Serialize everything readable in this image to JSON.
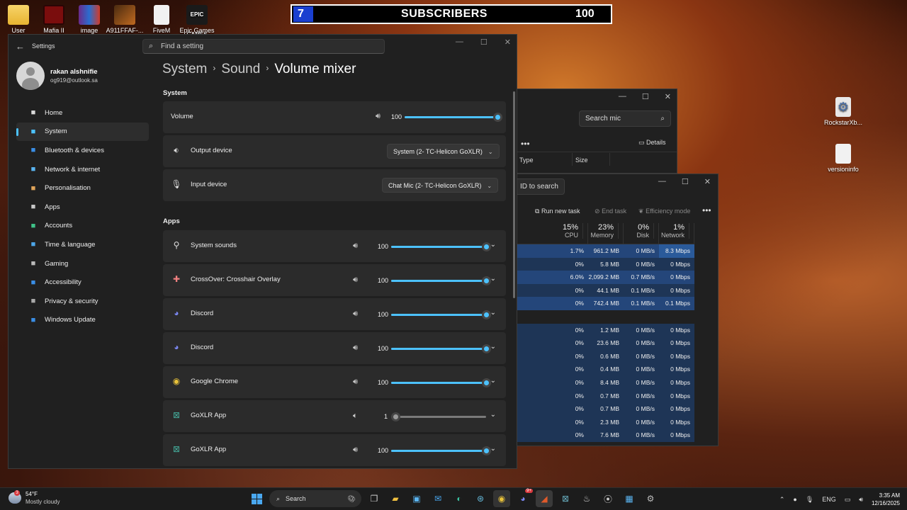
{
  "desktop": {
    "icons": [
      "User",
      "Mafia II",
      "image",
      "A911FFAF-...",
      "FiveM",
      "Epic Games"
    ],
    "right_icons": [
      "RockstarXb...",
      "versioninfo"
    ],
    "epic_logo": "EPIC GAMES"
  },
  "banner": {
    "number": "7",
    "label": "SUBSCRIBERS",
    "count": "100"
  },
  "explorer": {
    "search_placeholder": "Search mic",
    "details": "Details",
    "col_type": "Type",
    "col_size": "Size"
  },
  "task_manager": {
    "search_placeholder": "ID to search",
    "run_new_task": "Run new task",
    "end_task": "End task",
    "efficiency_mode": "Efficiency mode",
    "headers": [
      {
        "pct": "15%",
        "name": "CPU"
      },
      {
        "pct": "23%",
        "name": "Memory"
      },
      {
        "pct": "0%",
        "name": "Disk"
      },
      {
        "pct": "1%",
        "name": "Network"
      }
    ],
    "rows": [
      [
        "1.7%",
        "961.2 MB",
        "0 MB/s",
        "8.3 Mbps"
      ],
      [
        "0%",
        "5.8 MB",
        "0 MB/s",
        "0 Mbps"
      ],
      [
        "6.0%",
        "2,099.2 MB",
        "0.7 MB/s",
        "0 Mbps"
      ],
      [
        "0%",
        "44.1 MB",
        "0.1 MB/s",
        "0 Mbps"
      ],
      [
        "0%",
        "742.4 MB",
        "0.1 MB/s",
        "0.1 Mbps"
      ],
      [
        "",
        "",
        "",
        ""
      ],
      [
        "0%",
        "1.2 MB",
        "0 MB/s",
        "0 Mbps"
      ],
      [
        "0%",
        "23.6 MB",
        "0 MB/s",
        "0 Mbps"
      ],
      [
        "0%",
        "0.6 MB",
        "0 MB/s",
        "0 Mbps"
      ],
      [
        "0%",
        "0.4 MB",
        "0 MB/s",
        "0 Mbps"
      ],
      [
        "0%",
        "8.4 MB",
        "0 MB/s",
        "0 Mbps"
      ],
      [
        "0%",
        "0.7 MB",
        "0 MB/s",
        "0 Mbps"
      ],
      [
        "0%",
        "0.7 MB",
        "0 MB/s",
        "0 Mbps"
      ],
      [
        "0%",
        "2.3 MB",
        "0 MB/s",
        "0 Mbps"
      ],
      [
        "0%",
        "7.6 MB",
        "0 MB/s",
        "0 Mbps"
      ]
    ]
  },
  "settings": {
    "app_title": "Settings",
    "search_placeholder": "Find a setting",
    "user": {
      "name": "rakan alshnifie",
      "email": "og919@outlook.sa"
    },
    "nav": [
      {
        "label": "Home",
        "icon": "home-icon",
        "color": "#d9d9d9"
      },
      {
        "label": "System",
        "icon": "system-icon",
        "color": "#4cc2ff",
        "active": true
      },
      {
        "label": "Bluetooth & devices",
        "icon": "bluetooth-icon",
        "color": "#3a8ee6"
      },
      {
        "label": "Network & internet",
        "icon": "network-icon",
        "color": "#5ab4f0"
      },
      {
        "label": "Personalisation",
        "icon": "brush-icon",
        "color": "#e0a45a"
      },
      {
        "label": "Apps",
        "icon": "apps-icon",
        "color": "#c9c9c9"
      },
      {
        "label": "Accounts",
        "icon": "accounts-icon",
        "color": "#3fc389"
      },
      {
        "label": "Time & language",
        "icon": "globe-icon",
        "color": "#4da6e8"
      },
      {
        "label": "Gaming",
        "icon": "gaming-icon",
        "color": "#bbbbbb"
      },
      {
        "label": "Accessibility",
        "icon": "accessibility-icon",
        "color": "#3a8ee6"
      },
      {
        "label": "Privacy & security",
        "icon": "shield-icon",
        "color": "#aaaaaa"
      },
      {
        "label": "Windows Update",
        "icon": "update-icon",
        "color": "#3a8ee6"
      }
    ],
    "breadcrumb": [
      "System",
      "Sound",
      "Volume mixer"
    ],
    "system_section": "System",
    "volume": {
      "label": "Volume",
      "value": "100",
      "level": 1.0
    },
    "output": {
      "label": "Output device",
      "value": "System (2- TC-Helicon GoXLR)"
    },
    "input": {
      "label": "Input device",
      "value": "Chat Mic (2- TC-Helicon GoXLR)"
    },
    "apps_section": "Apps",
    "apps": [
      {
        "name": "System sounds",
        "value": "100",
        "level": 1.0,
        "icon": "system-sounds-icon"
      },
      {
        "name": "CrossOver: Crosshair Overlay",
        "value": "100",
        "level": 1.0,
        "icon": "crossover-icon"
      },
      {
        "name": "Discord",
        "value": "100",
        "level": 1.0,
        "icon": "discord-icon"
      },
      {
        "name": "Discord",
        "value": "100",
        "level": 1.0,
        "icon": "discord-icon"
      },
      {
        "name": "Google Chrome",
        "value": "100",
        "level": 1.0,
        "icon": "chrome-icon"
      },
      {
        "name": "GoXLR App",
        "value": "1",
        "level": 0.01,
        "icon": "goxlr-icon"
      },
      {
        "name": "GoXLR App",
        "value": "100",
        "level": 1.0,
        "icon": "goxlr-icon"
      }
    ]
  },
  "taskbar": {
    "weather_temp": "54°F",
    "weather_desc": "Mostly cloudy",
    "weather_badge": "3",
    "search_label": "Search",
    "discord_badge": "9+",
    "language": "ENG",
    "time": "3:35 AM",
    "date": "12/16/2025"
  }
}
